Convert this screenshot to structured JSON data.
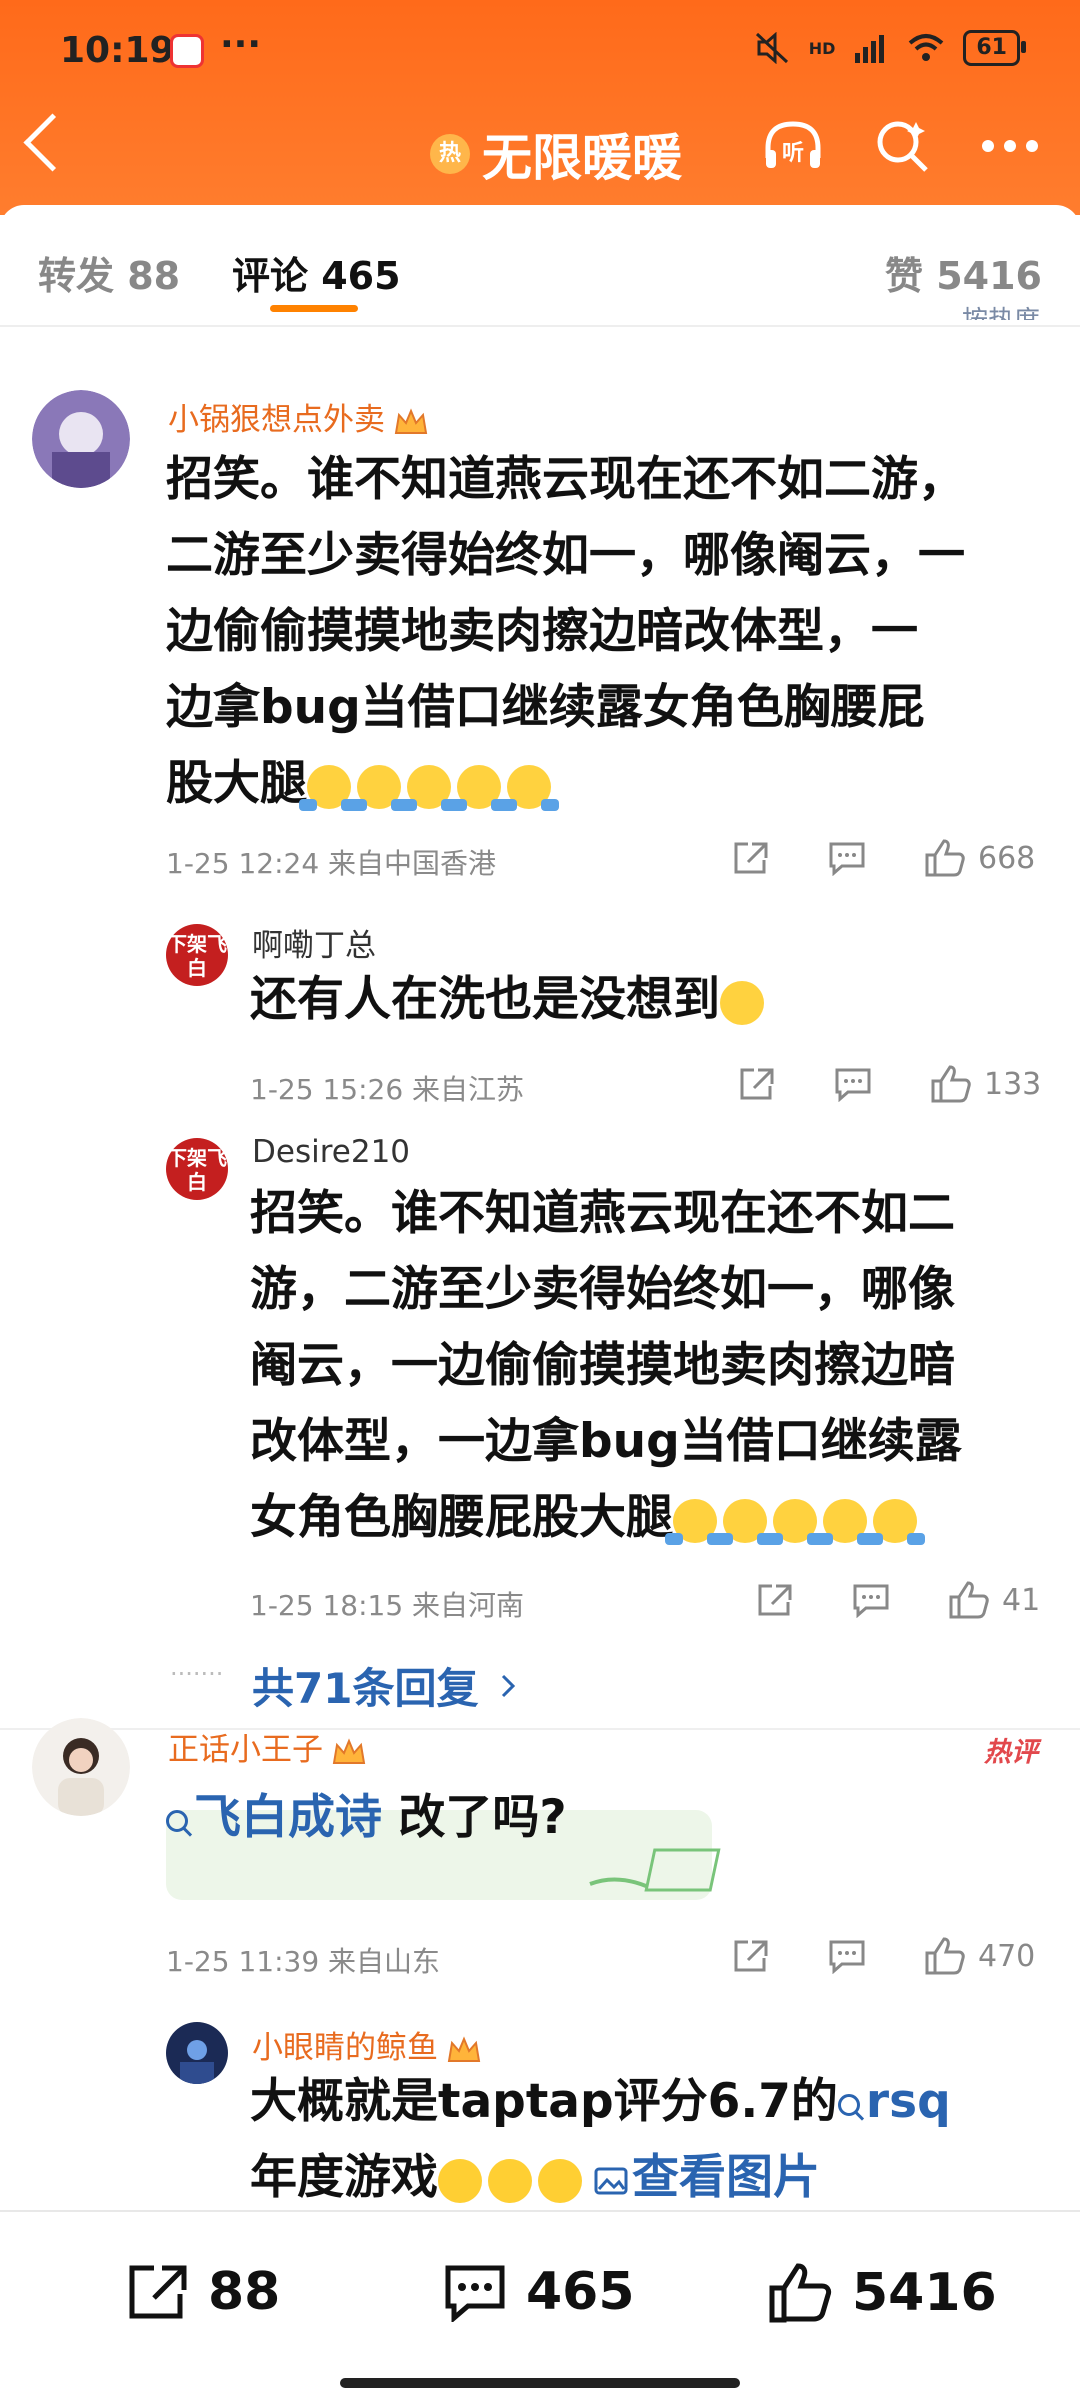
{
  "status_bar": {
    "time": "10:19",
    "dots": "···",
    "network": "HD",
    "battery": "61"
  },
  "nav": {
    "title": "无限暖暖",
    "hot_badge": "热",
    "listen_label": "听"
  },
  "tabs": [
    {
      "label": "转发 88"
    },
    {
      "label": "评论 465"
    },
    {
      "label": "赞 5416"
    }
  ],
  "sort_label": "按热度",
  "comments": [
    {
      "user": "小锅狠想点外卖",
      "lines": [
        "招笑。谁不知道燕云现在还不如二游，",
        "二游至少卖得始终如一，哪像阉云，一",
        "边偷偷摸摸地卖肉擦边暗改体型，一",
        "边拿bug当借口继续露女角色胸腰屁",
        "股大腿"
      ],
      "time": "1-25 12:24",
      "location": "来自中国香港",
      "likes": "668"
    },
    {
      "user": "啊嘞丁总",
      "avatar_text": "下架飞白",
      "text": "还有人在洗也是没想到",
      "time": "1-25 15:26",
      "location": "来自江苏",
      "likes": "133"
    },
    {
      "user": "Desire210",
      "avatar_text": "下架飞白",
      "lines": [
        "招笑。谁不知道燕云现在还不如二",
        "游，二游至少卖得始终如一，哪像",
        "阉云，一边偷偷摸摸地卖肉擦边暗",
        "改体型，一边拿bug当借口继续露",
        "女角色胸腰屁股大腿"
      ],
      "time": "1-25 18:15",
      "location": "来自河南",
      "likes": "41"
    },
    {
      "user": "正话小王子",
      "hot_tag": "热评",
      "link_text": "飞白成诗",
      "text": " 改了吗?",
      "time": "1-25 11:39",
      "location": "来自山东",
      "likes": "470"
    },
    {
      "user": "小眼睛的鲸鱼",
      "line1": "大概就是taptap评分6.7的",
      "link1": "rsq",
      "line2": "年度游戏",
      "image_link": "查看图片"
    }
  ],
  "more_replies": "共71条回复",
  "more_replies_dots": "·······",
  "bottom_bar": {
    "reposts": "88",
    "comments": "465",
    "likes": "5416"
  },
  "colors": {
    "header": "#ff7a28",
    "username": "#e86b1f",
    "link": "#2a64b0",
    "accent": "#ff8200"
  }
}
